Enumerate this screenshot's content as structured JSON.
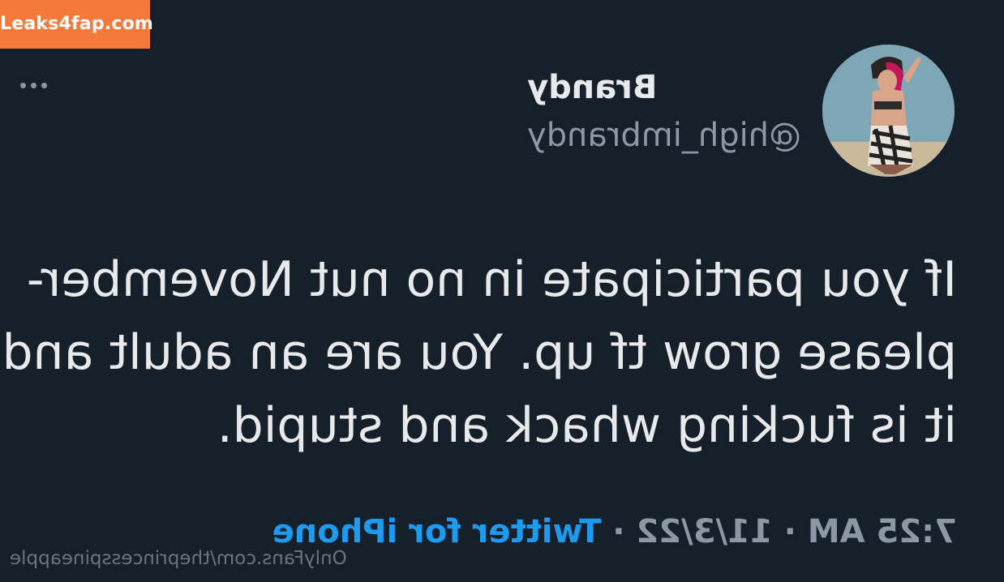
{
  "watermark": {
    "badge_text": "Leaks4fap.com",
    "footer_text": "OnlyFans.com/theprincesspineapple"
  },
  "tweet": {
    "display_name": "Brandy",
    "handle": "@high_imbrandy",
    "text_lines": [
      "If you participate in no nut November-",
      "please grow tf up. You are an adult and",
      "it is fucking whack and stupid."
    ],
    "time": "7:25 AM",
    "date": "11/3/22",
    "separator": " · ",
    "source": "Twitter for iPhone"
  },
  "icons": {
    "more": "more-horizontal-icon",
    "avatar": "profile-avatar"
  },
  "colors": {
    "background": "#15202b",
    "primary_text": "#e7e9ea",
    "secondary_text": "#8b98a5",
    "link": "#1d9bf0",
    "badge": "#f5793a"
  }
}
